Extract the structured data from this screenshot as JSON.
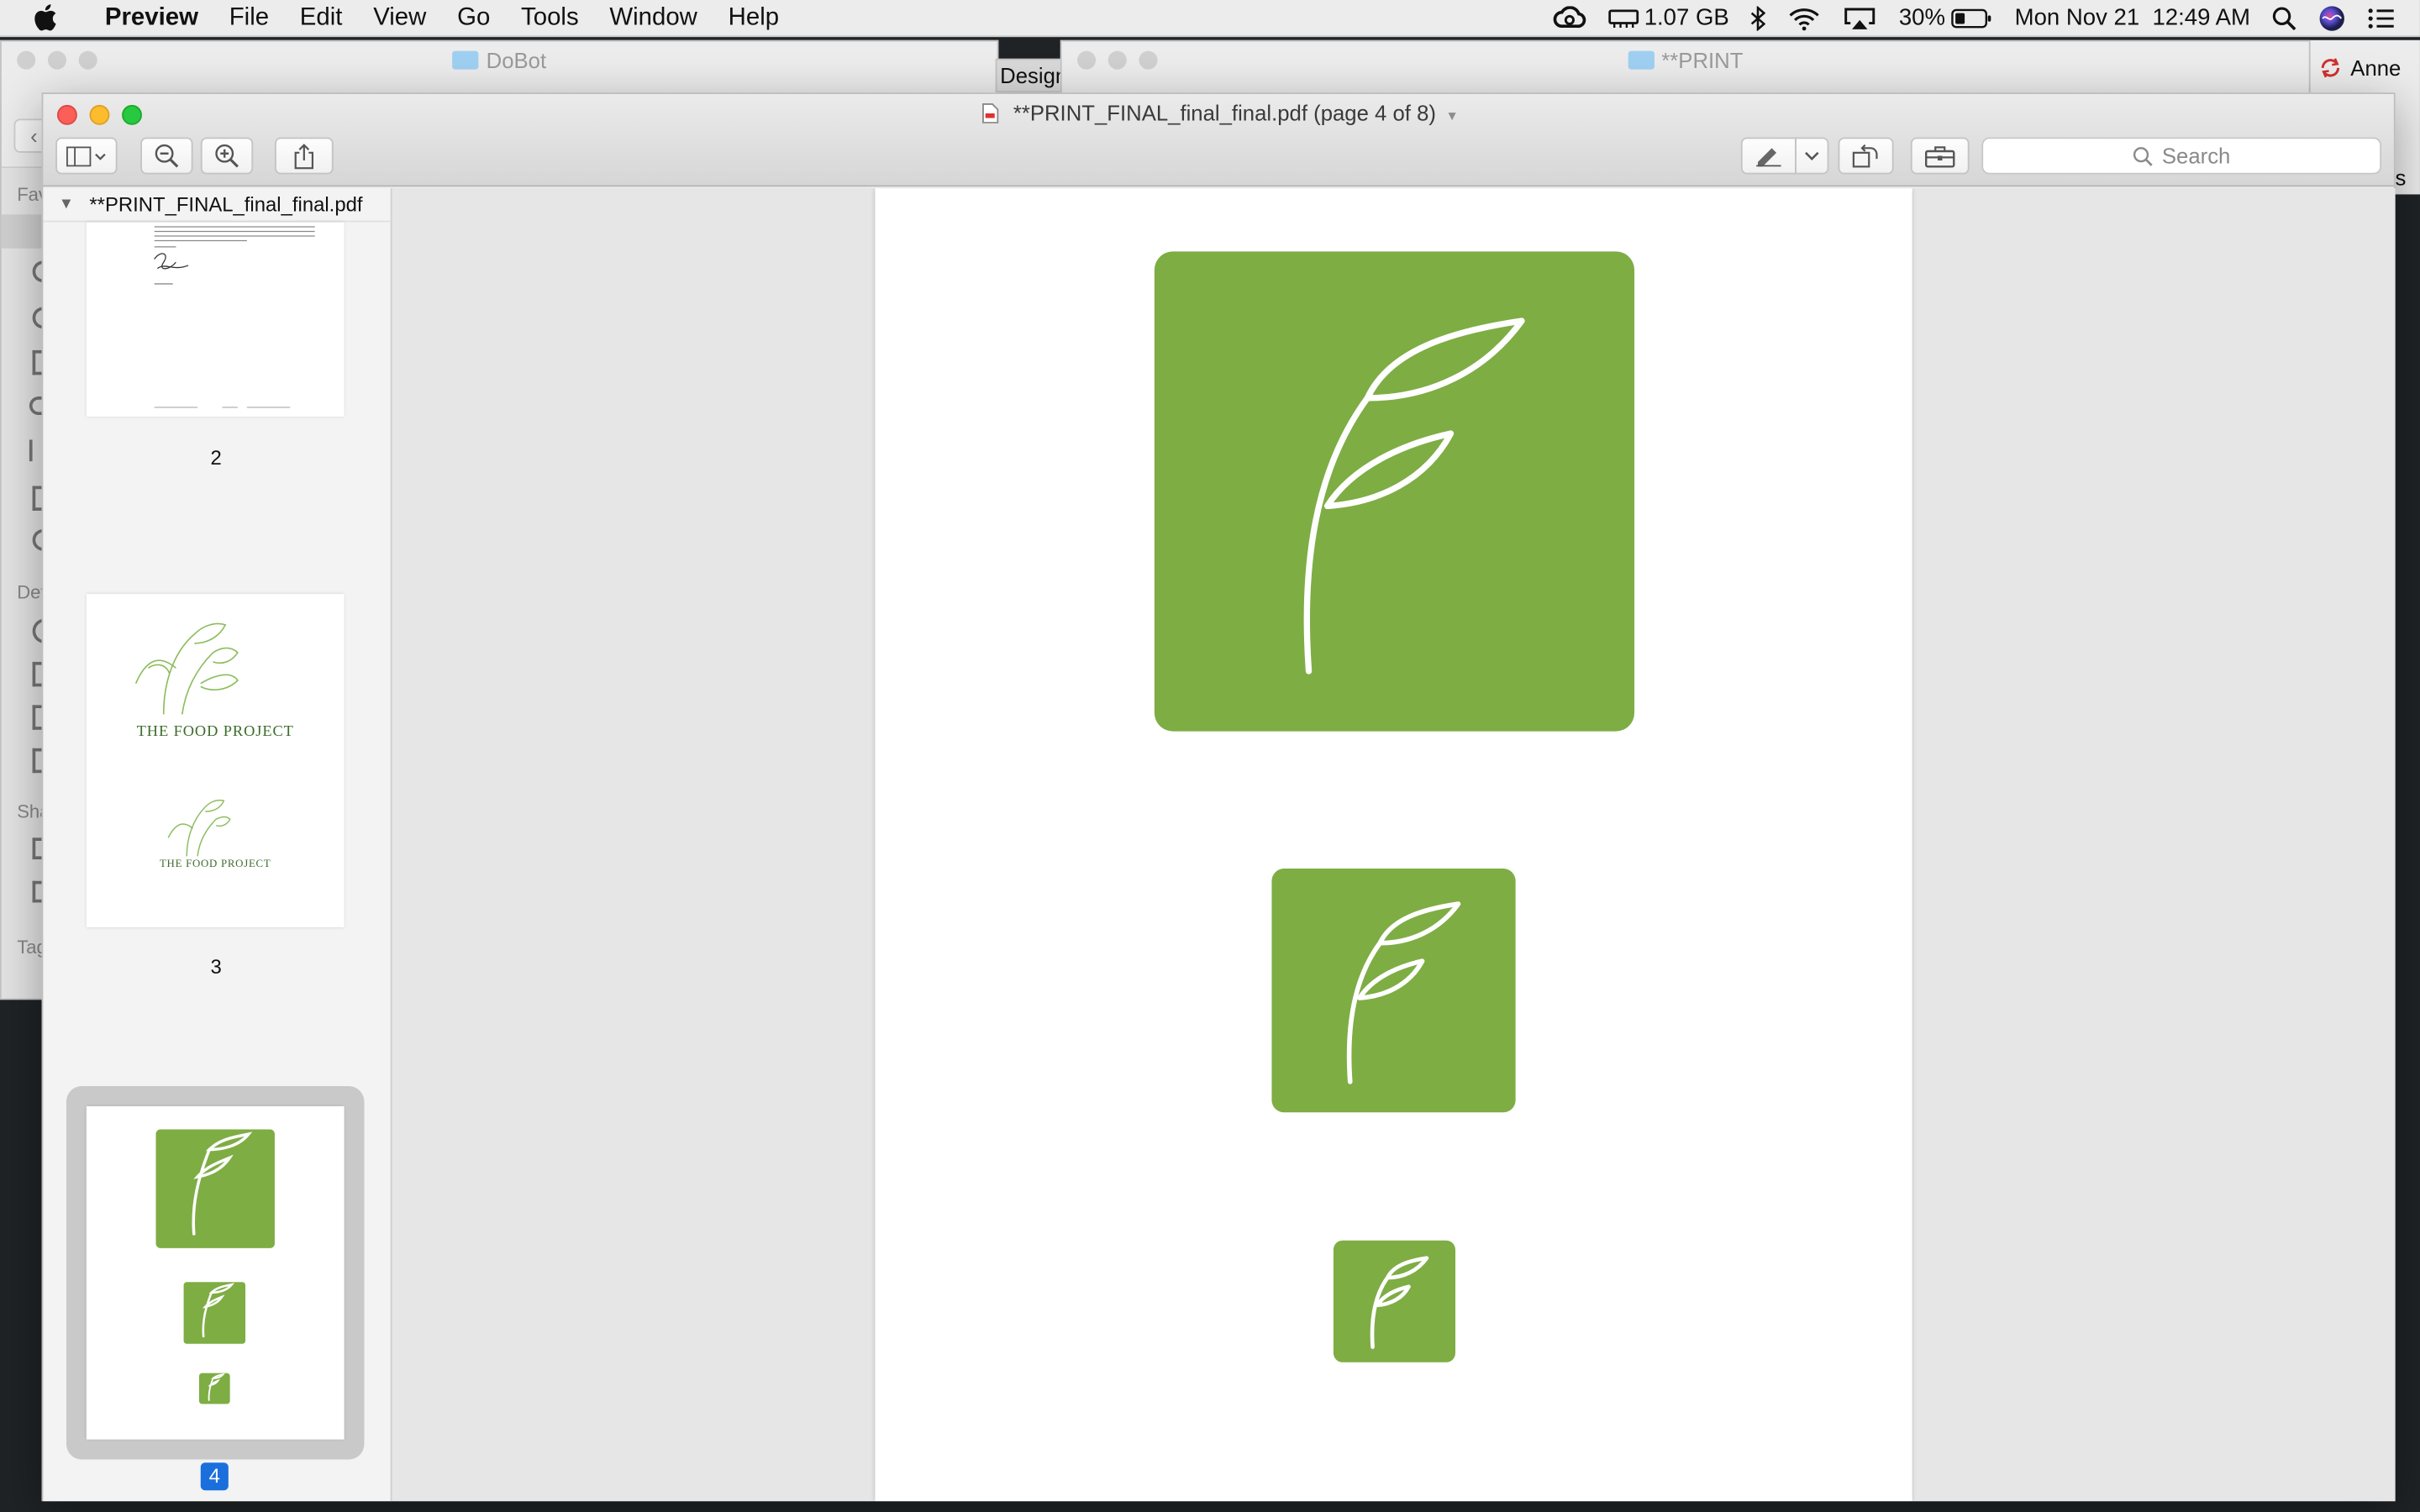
{
  "menubar": {
    "app": "Preview",
    "items": [
      "File",
      "Edit",
      "View",
      "Go",
      "Tools",
      "Window",
      "Help"
    ],
    "memory": "1.07 GB",
    "battery": "30%",
    "datetime": "Mon Nov 21  12:49 AM"
  },
  "background_windows": {
    "left_title": "DoBot",
    "left_tab": "Design",
    "right_title": "**PRINT",
    "right_user": "Anne",
    "sidebar_labels": [
      "Fav",
      "Dev",
      "Sha",
      "Tag"
    ],
    "right_edge_char": "s"
  },
  "window": {
    "title": "**PRINT_FINAL_final_final.pdf (page 4 of 8)",
    "search_placeholder": "Search"
  },
  "sidebar": {
    "document_name": "**PRINT_FINAL_final_final.pdf",
    "pages": [
      {
        "number": "2"
      },
      {
        "number": "3",
        "wordmark_large": "THE FOOD PROJECT",
        "wordmark_small": "THE FOOD PROJECT"
      },
      {
        "number": "4",
        "selected": true
      }
    ]
  },
  "colors": {
    "accent_green": "#7ead44",
    "selection_blue": "#1a6fdc"
  }
}
